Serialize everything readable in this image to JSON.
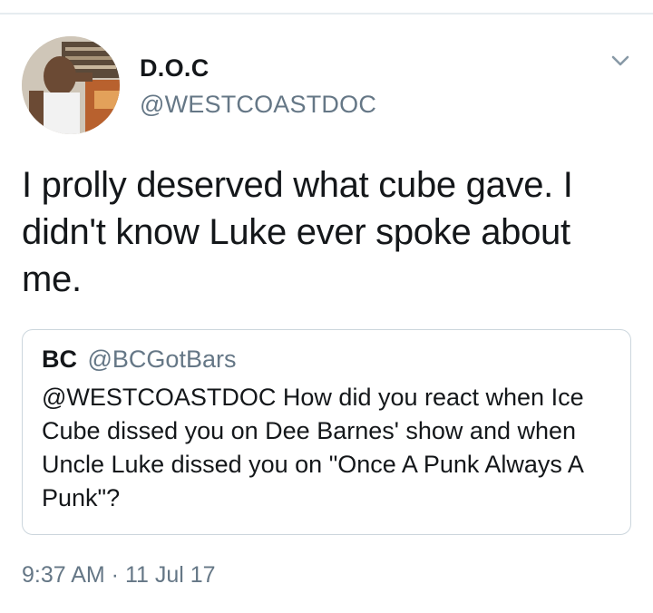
{
  "tweet": {
    "author": {
      "display_name": "D.O.C",
      "handle": "@WESTCOASTDOC",
      "avatar_icon": "profile-photo"
    },
    "more_options_icon": "chevron-down-icon",
    "text": "I prolly deserved what cube gave. I didn't know Luke ever spoke about me.",
    "quoted_tweet": {
      "author_name": "BC",
      "author_handle": "@BCGotBars",
      "text": "@WESTCOASTDOC How did you react when Ice Cube dissed you on Dee Barnes' show and when Uncle Luke dissed you on \"Once A Punk Always A Punk\"?"
    },
    "timestamp": "9:37 AM · 11 Jul 17"
  },
  "colors": {
    "primary_text": "#14171a",
    "secondary_text": "#657786",
    "border": "#ccd6dd",
    "divider": "#e6ecf0"
  }
}
